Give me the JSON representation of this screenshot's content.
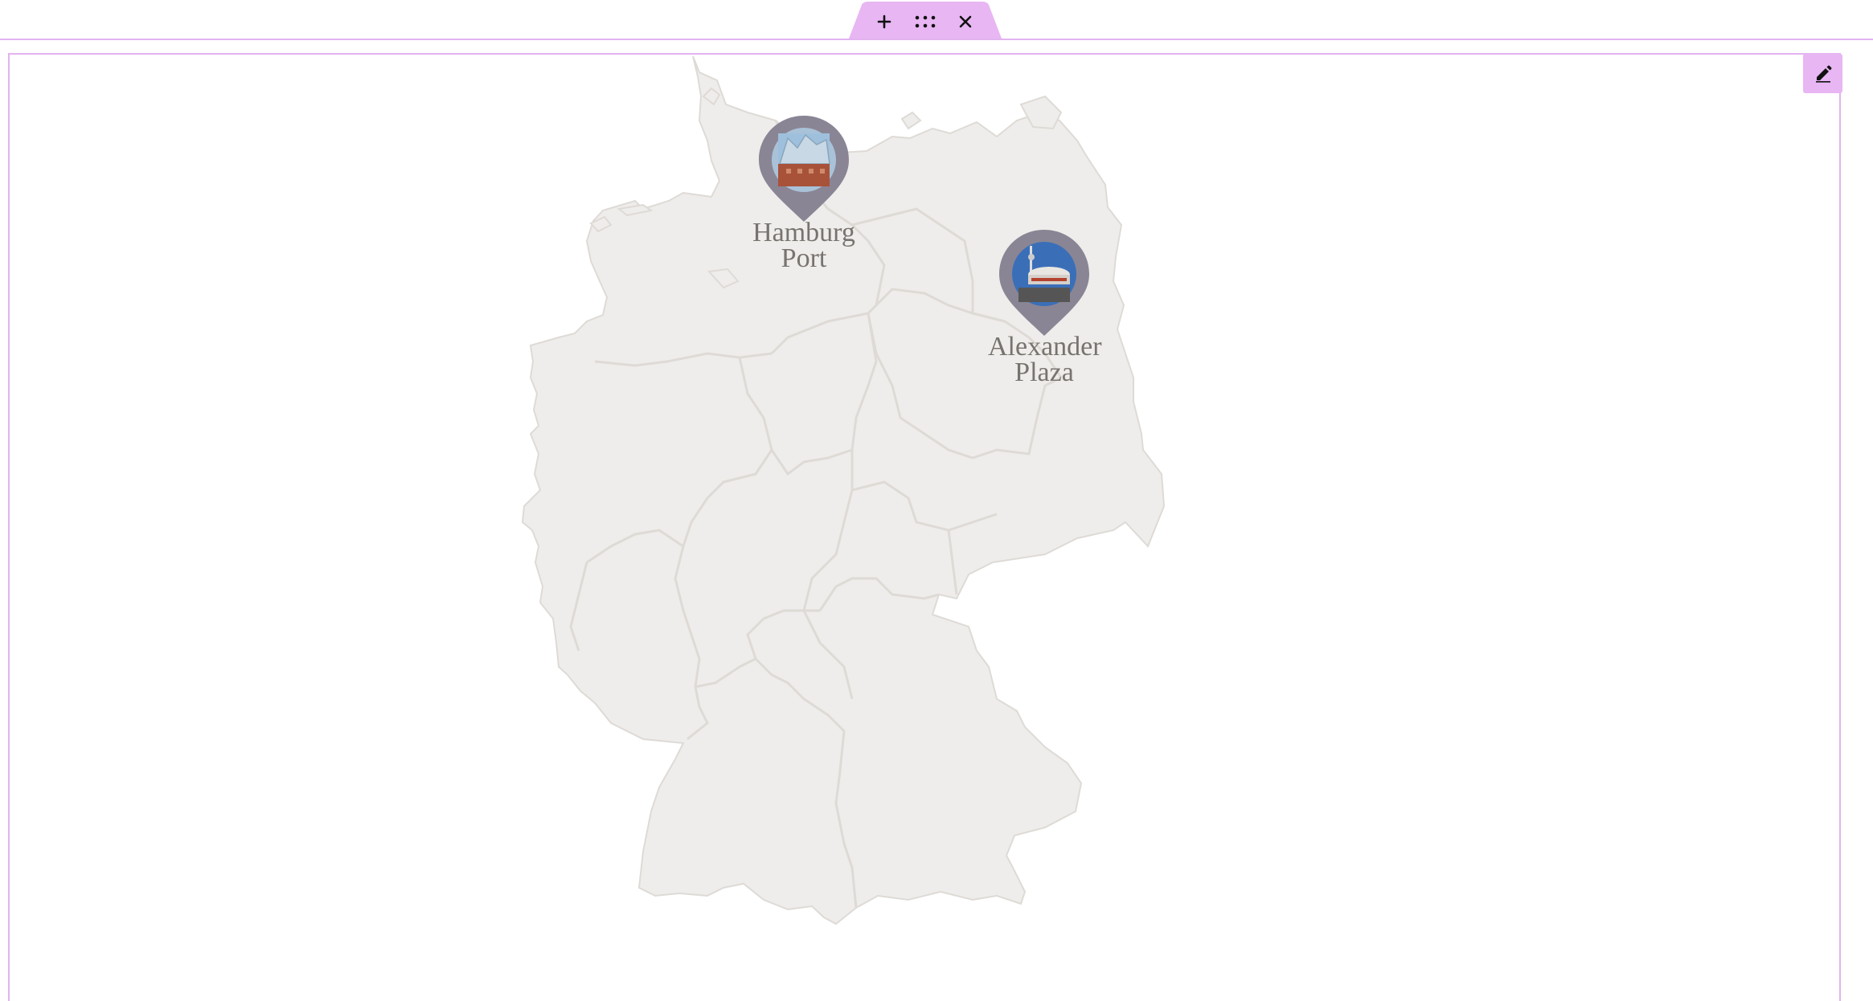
{
  "editor": {
    "add_icon": "plus-icon",
    "move_icon": "drag-dots-icon",
    "close_icon": "close-icon",
    "edit_icon": "pencil-icon",
    "accent_color": "#e8b6f3"
  },
  "map": {
    "region": "Germany",
    "land_color": "#efedeb",
    "border_color": "#dedad6",
    "markers": [
      {
        "label_line1": "Hamburg",
        "label_line2": "Port",
        "pin_color": "#8a8594"
      },
      {
        "label_line1": "Alexander",
        "label_line2": "Plaza",
        "pin_color": "#8a8594"
      }
    ]
  }
}
